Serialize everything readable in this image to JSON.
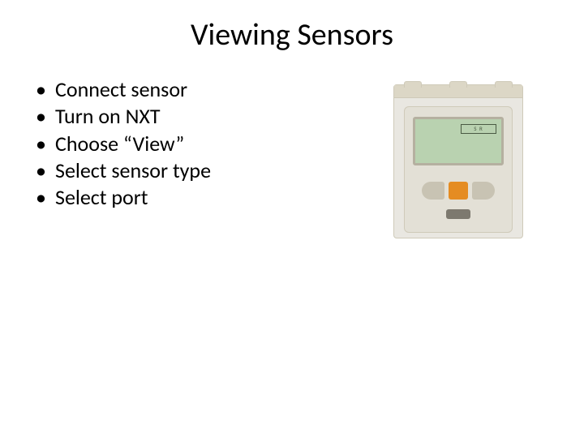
{
  "title": "Viewing Sensors",
  "bullets": [
    "Connect sensor",
    "Turn on NXT",
    "Choose “View”",
    "Select sensor type",
    "Select port"
  ],
  "device": {
    "screen_label": "S R"
  }
}
